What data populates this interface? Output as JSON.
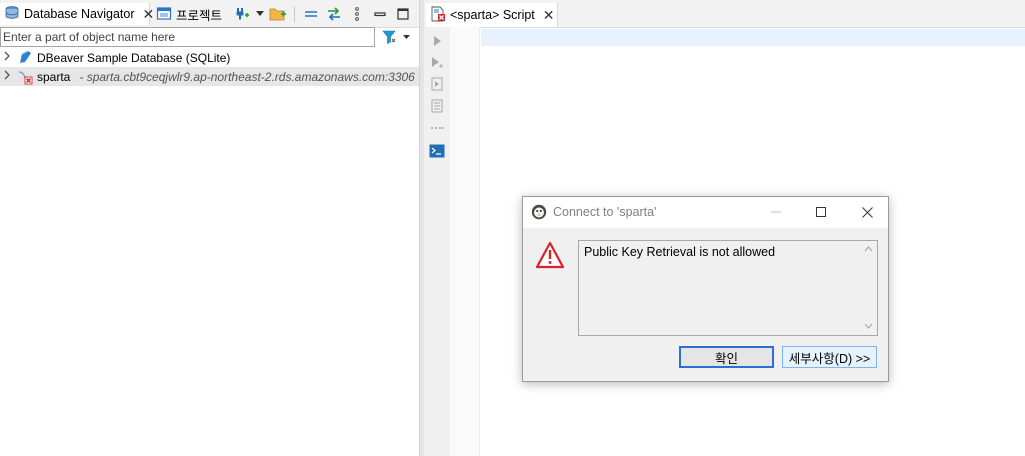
{
  "left_panel": {
    "tabs": [
      {
        "label": "Database Navigator",
        "icon": "database-navigator-icon"
      },
      {
        "label": "프로젝트",
        "icon": "projects-icon"
      }
    ],
    "toolbar_icons": [
      "new-connection-icon",
      "dropdown-icon",
      "new-folder-icon",
      "collapse-all-icon",
      "link-editor-icon",
      "view-menu-icon",
      "minimize-icon",
      "maximize-icon"
    ],
    "search": {
      "placeholder": "Enter a part of object name here",
      "value": ""
    },
    "tree": [
      {
        "label": "DBeaver Sample Database (SQLite)",
        "icon": "sqlite-db-icon",
        "description": ""
      },
      {
        "label": "sparta",
        "icon": "mysql-disconnected-icon",
        "description": "- sparta.cbt9ceqjwlr9.ap-northeast-2.rds.amazonaws.com:3306"
      }
    ]
  },
  "editor": {
    "tab": {
      "label": "<sparta> Script",
      "icon": "sql-script-error-icon"
    },
    "sidebar_icons": [
      "execute-statement-icon",
      "execute-script-icon",
      "explain-plan-icon",
      "load-script-icon",
      "more-icon",
      "terminal-icon"
    ]
  },
  "dialog": {
    "title": "Connect to 'sparta'",
    "message": "Public Key Retrieval is not allowed",
    "ok_label": "확인",
    "details_label": "세부사항(D) >>",
    "colors": {
      "warning": "#d9232a",
      "focus_border": "#2e6fd6",
      "details_bg": "#e5f1fb"
    }
  },
  "colors": {
    "selected_row": "#e6e6e6",
    "current_line": "#e8f2fe",
    "tab_bar": "#f2f2f2"
  }
}
